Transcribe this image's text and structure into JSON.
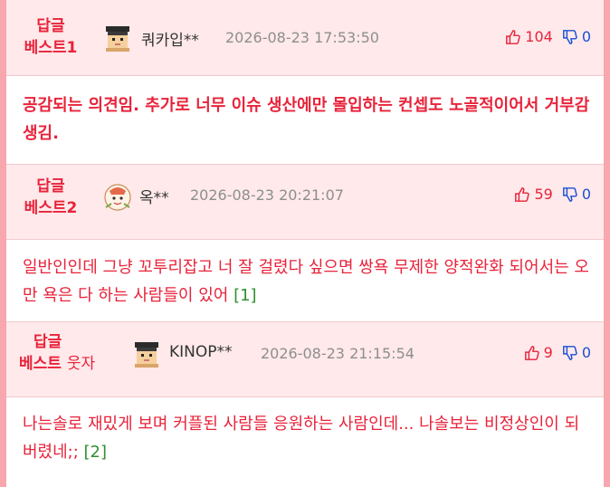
{
  "comments": [
    {
      "badge_line1": "답글",
      "badge_line2": "베스트1",
      "badge_tail": "",
      "nickname": "쿼카입**",
      "date": "2026-08-23 17:53:50",
      "likes": "104",
      "dislikes": "0",
      "text": "공감되는 의견임. 추가로 너무 이슈 생산에만 몰입하는 컨셉도 노골적이어서 거부감 생김.",
      "reply_count": ""
    },
    {
      "badge_line1": "답글",
      "badge_line2": "베스트2",
      "badge_tail": "",
      "nickname": "옥**",
      "date": "2026-08-23 20:21:07",
      "likes": "59",
      "dislikes": "0",
      "text": "일반인인데 그냥 꼬투리잡고 너 잘 걸렸다 싶으면 쌍욕 무제한 양적완화 되어서는 오만 욕은 다 하는 사람들이 있어 ",
      "reply_count": "[1]"
    },
    {
      "badge_line1": "답글",
      "badge_line2": "베스트",
      "badge_tail": "웃자",
      "nickname": "KINOP**",
      "date": "2026-08-23 21:15:54",
      "likes": "9",
      "dislikes": "0",
      "text": "나는솔로 재밌게 보며 커플된 사람들 응원하는 사람인데... 나솔보는 비정상인이 되버렸네;; ",
      "reply_count": "[2]"
    }
  ],
  "colors": {
    "accent": "#e8233a",
    "dislike": "#1a4fd6",
    "header_bg": "#ffe9ea",
    "frame": "#f7a7ad",
    "reply": "#2f8f2f"
  },
  "icons": {
    "like": "thumbs-up-outline-icon",
    "dislike": "thumbs-down-outline-icon"
  }
}
